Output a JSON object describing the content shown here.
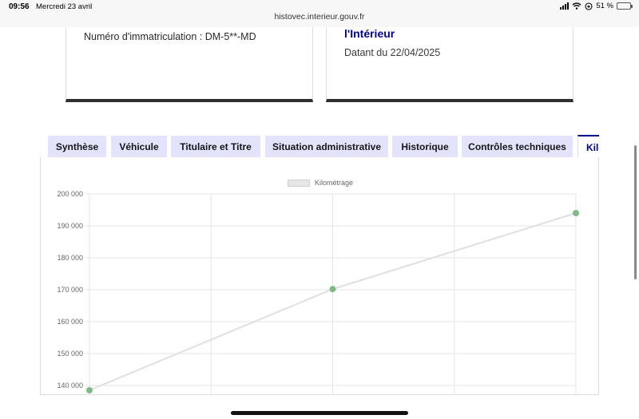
{
  "status_bar": {
    "time": "09:56",
    "date": "Mercredi 23 avril",
    "url": "histovec.interieur.gouv.fr",
    "battery": "51 %"
  },
  "cards": {
    "plate_text": "Numéro d'immatriculation : DM-5**-MD",
    "org_text": "l'Intérieur",
    "dated_text": "Datant du 22/04/2025"
  },
  "tabs": [
    {
      "label": "Synthèse"
    },
    {
      "label": "Véhicule"
    },
    {
      "label": "Titulaire et Titre"
    },
    {
      "label": "Situation administrative"
    },
    {
      "label": "Historique"
    },
    {
      "label": "Contrôles techniques"
    },
    {
      "label": "Kilométrage",
      "active": true
    }
  ],
  "chart_data": {
    "type": "line",
    "title": "",
    "xlabel": "",
    "ylabel": "",
    "series": [
      {
        "name": "Kilométrage",
        "x": [
          0,
          3,
          6
        ],
        "values": [
          138500,
          170200,
          194000
        ]
      }
    ],
    "y_ticks": [
      "140 000",
      "150 000",
      "160 000",
      "170 000",
      "180 000",
      "190 000",
      "200 000"
    ],
    "ylim": [
      137000,
      200000
    ],
    "xlim": [
      0,
      6
    ],
    "grid": true,
    "legend": "top-center",
    "line_color": "#e0e0e0",
    "point_color": "#7dba84"
  }
}
